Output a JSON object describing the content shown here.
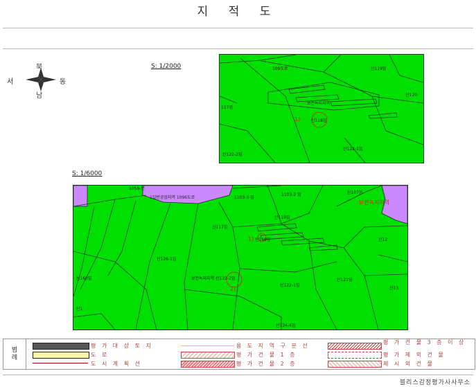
{
  "page": {
    "title": "지 적 도",
    "footer": "블리스감정평가사사무소"
  },
  "compass": {
    "north": "북",
    "south": "남",
    "west": "서",
    "east": "동"
  },
  "map_small": {
    "scale_label": "S: 1/2000",
    "labels": [
      "109도로",
      "산119임",
      "산120",
      "보전녹지지역",
      "117임",
      "1)",
      "산118임",
      "산122-2임",
      "산122-1임"
    ]
  },
  "map_large": {
    "scale_label": "S: 1/6000",
    "labels": [
      "1058-전",
      "1일반공업지역 1096도로",
      "1103-3 임",
      "1103-2 임",
      "산107임",
      "보전녹지지역",
      "산119임",
      "산117임",
      "1)",
      "산118임",
      "산126-1임",
      "산160임",
      "보전녹지지역 산122-2임",
      "2)",
      "산122-1임",
      "산121임",
      "산124-4임",
      "산12",
      "산13",
      "산1"
    ]
  },
  "legend": {
    "side_label": [
      "범",
      "례"
    ],
    "items": [
      "평 가 대 상 토 지",
      "도 로",
      "도 시 계 획 선",
      "용 도 지 역 구 분 선",
      "평 가 건 물 1 층",
      "평 가 건 물 2 층",
      "평 가 건 물 3 층 이 상",
      "평 가 제 외 건 물",
      "제 시 외 건 물"
    ]
  },
  "colors": {
    "parcel_green": "#00e000",
    "zone_purple": "#cc88ff",
    "marker_red": "#e02020"
  }
}
